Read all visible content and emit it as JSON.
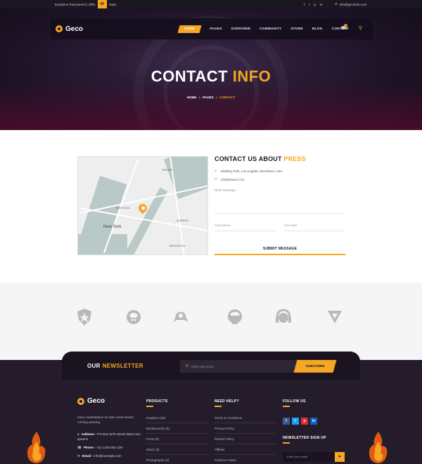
{
  "topbar": {
    "promo_text": "Exclusive Tournament | Offer",
    "days_value": "00",
    "days_label": "Days",
    "social_icons": [
      "facebook-icon",
      "twitter-icon",
      "pinterest-icon",
      "linkedin-icon"
    ],
    "email": "info@gecoinfo.com"
  },
  "nav": {
    "brand": "Geco",
    "items": [
      {
        "label": "HOME",
        "active": true
      },
      {
        "label": "PAGES",
        "active": false
      },
      {
        "label": "OVERVIEW",
        "active": false
      },
      {
        "label": "COMMUNITY",
        "active": false
      },
      {
        "label": "STORE",
        "active": false
      },
      {
        "label": "BLOG",
        "active": false
      },
      {
        "label": "CONTACT",
        "active": false
      }
    ],
    "cart_count": "0"
  },
  "hero": {
    "title_main": "CONTACT",
    "title_accent": "INFO",
    "breadcrumb": [
      "HOME",
      "PAGES",
      "CONTACT"
    ]
  },
  "map": {
    "city_label": "New York",
    "area_labels": [
      "MIDTOWN",
      "QUEENS",
      "BROOKLYN",
      "BRONX"
    ]
  },
  "contact": {
    "title_main": "CONTACT US ABOUT",
    "title_accent": "PRESS",
    "address": "Walking Park, Los Angeles, Brockland, USA",
    "email": "info@exaux.com",
    "message_placeholder": "Write Message...",
    "name_placeholder": "Your Name",
    "mail_placeholder": "Your Mail",
    "submit_label": "SUBMIT MESSAGE"
  },
  "newsletter": {
    "title_main": "OUR",
    "title_accent": "NEWSLETTER",
    "input_placeholder": "Enter your email...",
    "button_label": "SUBSCRIBE"
  },
  "footer": {
    "brand": "Geco",
    "about": "Geco marketplace of raise etras sheets coming passing.",
    "address_label": "Address :",
    "address_value": "PO Box W75 Street West new queens",
    "phone_label": "Phone :",
    "phone_value": "+24 1245 654 235",
    "email_label": "Email :",
    "email_value": "info@exemple.com",
    "products_title": "PRODUCTS",
    "products": [
      "Graphics (26)",
      "Backgrounds (5)",
      "Fonts (6)",
      "Music (3)",
      "Photography (3)"
    ],
    "help_title": "NEED HELP?",
    "help_links": [
      "Terms & Conditions",
      "Privacy Policy",
      "Refund Policy",
      "Affiliate",
      "FAQUse Cases"
    ],
    "follow_title": "FOLLOW US",
    "follow_icons": [
      {
        "icon": "facebook-icon",
        "glyph": "f",
        "color": "#3b5998"
      },
      {
        "icon": "twitter-icon",
        "glyph": "t",
        "color": "#1da1f2"
      },
      {
        "icon": "pinterest-icon",
        "glyph": "p",
        "color": "#e02a36"
      },
      {
        "icon": "linkedin-icon",
        "glyph": "in",
        "color": "#0a66c2"
      }
    ],
    "signup_title": "NEWSLETTER SIGN UP",
    "signup_placeholder": "Enter your email"
  },
  "colors": {
    "accent": "#f5a623",
    "dark": "#1b1722",
    "footer_bg": "#241c2b"
  }
}
